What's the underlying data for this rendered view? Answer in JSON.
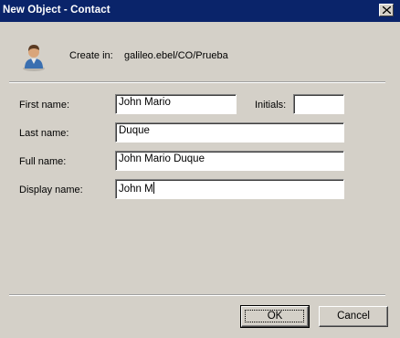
{
  "window": {
    "title": "New Object - Contact",
    "close_icon": "close-icon"
  },
  "header": {
    "icon": "contact-person-icon",
    "create_in_label": "Create in:",
    "create_in_value": "galileo.ebel/CO/Prueba"
  },
  "form": {
    "first_name_label": "First name:",
    "first_name_value": "John Mario",
    "initials_label": "Initials:",
    "initials_value": "",
    "last_name_label": "Last name:",
    "last_name_value": "Duque",
    "full_name_label": "Full name:",
    "full_name_value": "John Mario Duque",
    "display_name_label": "Display name:",
    "display_name_value": "John M"
  },
  "buttons": {
    "ok_label": "OK",
    "cancel_label": "Cancel"
  },
  "colors": {
    "title_bar": "#0a246a",
    "dialog_bg": "#d4d0c8"
  }
}
